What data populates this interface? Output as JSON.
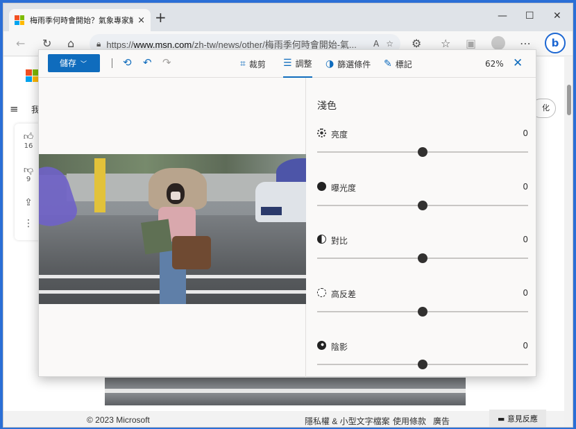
{
  "browser": {
    "tab_title": "梅雨季何時會開始？氣象專家解",
    "tab_close": "×",
    "new_tab": "+",
    "minimize": "—",
    "maximize": "☐",
    "close": "✕",
    "url_prefix": "https://",
    "url_domain": "www.msn.com",
    "url_path": "/zh-tw/news/other/梅雨季何時會開始-氣...",
    "logo_colors": [
      "#f25022",
      "#7fba00",
      "#00a4ef",
      "#ffb900"
    ]
  },
  "page": {
    "fragment": "我",
    "pill_button": "化",
    "likes": "16",
    "dislikes": "9",
    "footer_copyright": "© 2023 Microsoft",
    "footer_privacy": "隱私權 & 小型文字檔案",
    "footer_terms": "使用條款",
    "footer_ads": "廣告",
    "feedback": "意見反應"
  },
  "editor": {
    "save_label": "儲存",
    "tools": [
      {
        "label": "裁剪",
        "icon": "crop-icon",
        "glyph": "⌗"
      },
      {
        "label": "調整",
        "icon": "adjust-icon",
        "glyph": "☰"
      },
      {
        "label": "篩選條件",
        "icon": "filter-icon",
        "glyph": "◑"
      },
      {
        "label": "標記",
        "icon": "markup-icon",
        "glyph": "✎"
      }
    ],
    "active_tool": "調整",
    "zoom": "62%",
    "close": "✕",
    "panel_title": "淺色",
    "sliders": [
      {
        "label": "亮度",
        "value": "0",
        "level": 0.5,
        "icon": "brightness-icon"
      },
      {
        "label": "曝光度",
        "value": "0",
        "level": 0.5,
        "icon": "exposure-icon"
      },
      {
        "label": "對比",
        "value": "0",
        "level": 0.5,
        "icon": "contrast-icon"
      },
      {
        "label": "高反差",
        "value": "0",
        "level": 0.5,
        "icon": "highlights-icon"
      },
      {
        "label": "陰影",
        "value": "0",
        "level": 0.5,
        "icon": "shadows-icon"
      }
    ],
    "accent": "#0f6cbd"
  }
}
